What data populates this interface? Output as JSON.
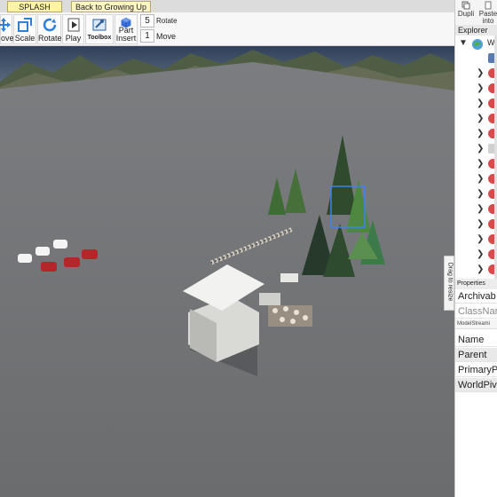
{
  "tabs": [
    {
      "label": "SPLASH",
      "active": true
    },
    {
      "label": "Back to Growing Up",
      "active": false
    }
  ],
  "toolbar": {
    "move_label": "ove",
    "scale_label": "Scale",
    "rotate_label": "Rotate",
    "play_label": "Play",
    "toolbox_label": "Toolbox",
    "part_label": "Part",
    "insert_label": "Insert",
    "rotate_step_value": "5",
    "rotate_step_label": "Rotate",
    "move_step_value": "1",
    "move_step_label": "Move"
  },
  "dock_top": {
    "duplicate_label": "Dupli",
    "paste_line1": "Paste",
    "paste_line2": "into"
  },
  "explorer": {
    "title": "Explorer",
    "root_label": "W",
    "child_count_visible": 15
  },
  "drag_handle": {
    "label": "Drag to resize"
  },
  "properties": {
    "title": "Properties",
    "archivable": "Archivab",
    "classname": "ClassNar",
    "category": "ModelStreami",
    "name": "Name",
    "parent": "Parent",
    "primary": "PrimaryP",
    "worldpivot": "WorldPiv"
  },
  "colors": {
    "accent_blue": "#3b82f6",
    "tab_yellow": "#fff3a8",
    "baseplate": "#6f7173"
  }
}
